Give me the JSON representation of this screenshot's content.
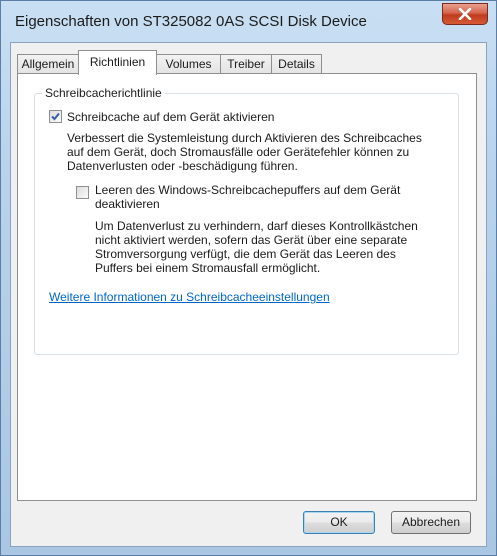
{
  "window": {
    "title": "Eigenschaften von ST325082 0AS SCSI Disk Device"
  },
  "tabs": [
    {
      "label": "Allgemein"
    },
    {
      "label": "Richtlinien",
      "active": true
    },
    {
      "label": "Volumes"
    },
    {
      "label": "Treiber"
    },
    {
      "label": "Details"
    }
  ],
  "group": {
    "title": "Schreibcacherichtlinie",
    "write_cache": {
      "label": "Schreibcache auf dem Gerät aktivieren",
      "checked": true,
      "description": [
        "Verbessert die Systemleistung durch Aktivieren des Schreibcaches",
        "auf dem Gerät, doch Stromausfälle oder Gerätefehler können zu",
        "Datenverlusten oder -beschädigung führen."
      ]
    },
    "flush": {
      "label": [
        "Leeren des Windows-Schreibcachepuffers auf dem Gerät",
        "deaktivieren"
      ],
      "checked": false,
      "description": [
        "Um Datenverlust zu verhindern, darf dieses Kontrollkästchen",
        "nicht aktiviert werden, sofern das Gerät über eine separate",
        "Stromversorgung verfügt, die dem Gerät das Leeren des",
        "Puffers bei einem Stromausfall ermöglicht."
      ]
    },
    "more_info_link": "Weitere Informationen zu Schreibcacheeinstellungen"
  },
  "buttons": {
    "ok": "OK",
    "cancel": "Abbrechen"
  },
  "icons": {
    "close": "close-icon",
    "check": "checkmark-icon"
  },
  "colors": {
    "link": "#0066cc",
    "close_button": "#c03b1e",
    "check": "#3a5ea8"
  }
}
